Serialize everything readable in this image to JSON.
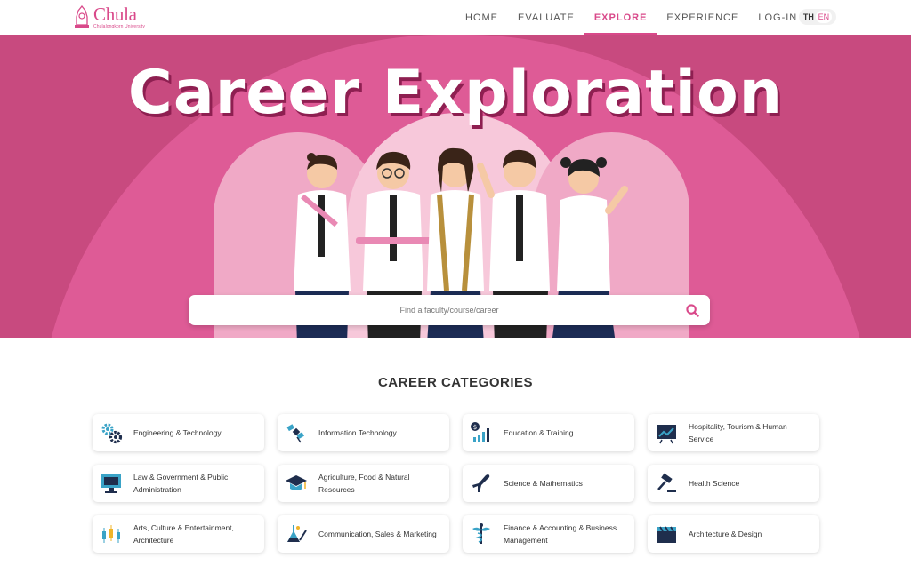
{
  "brand": {
    "name": "Chula",
    "subtitle": "Chulalongkorn University"
  },
  "nav": {
    "items": [
      "HOME",
      "EVALUATE",
      "EXPLORE",
      "EXPERIENCE",
      "LOG-IN"
    ],
    "active": "EXPLORE"
  },
  "lang": {
    "th": "TH",
    "en": "EN"
  },
  "hero": {
    "title": "Career Exploration"
  },
  "search": {
    "placeholder": "Find a faculty/course/career"
  },
  "categories": {
    "title": "CAREER CATEGORIES",
    "items": [
      {
        "label": "Engineering & Technology",
        "icon": "gears-icon"
      },
      {
        "label": "Information Technology",
        "icon": "satellite-icon"
      },
      {
        "label": "Education & Training",
        "icon": "bar-chart-icon"
      },
      {
        "label": "Hospitality, Tourism & Human Service",
        "icon": "presentation-icon"
      },
      {
        "label": "Law & Government & Public Administration",
        "icon": "monitor-icon"
      },
      {
        "label": "Agriculture, Food & Natural Resources",
        "icon": "graduation-cap-icon"
      },
      {
        "label": "Science & Mathematics",
        "icon": "airplane-icon"
      },
      {
        "label": "Health Science",
        "icon": "gavel-icon"
      },
      {
        "label": "Arts, Culture & Entertainment, Architecture",
        "icon": "candlestick-icon"
      },
      {
        "label": "Communication, Sales & Marketing",
        "icon": "lab-flask-icon"
      },
      {
        "label": "Finance & Accounting & Business Management",
        "icon": "caduceus-icon"
      },
      {
        "label": "Architecture & Design",
        "icon": "clapperboard-icon"
      }
    ]
  },
  "colors": {
    "brand": "#d9498a",
    "hero_dark": "#c84a7f",
    "hero_light": "#de5b96"
  }
}
